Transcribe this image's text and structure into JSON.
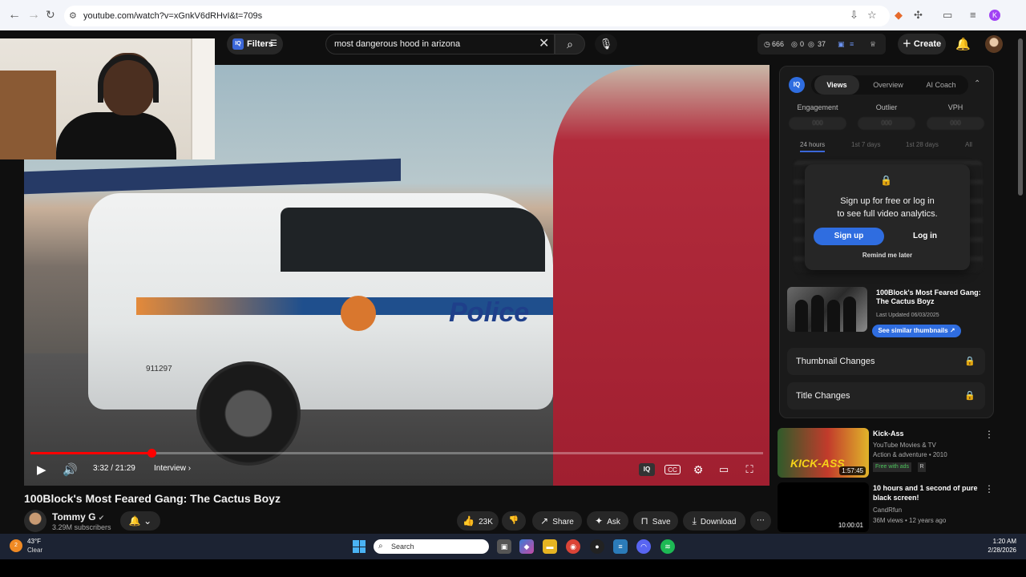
{
  "browser": {
    "url": "youtube.com/watch?v=xGnkV6dRHvI&t=709s",
    "profile_initial": "K"
  },
  "header": {
    "filters_label": "Filters",
    "search_query": "most dangerous hood in arizona",
    "stats": {
      "views": "666",
      "likes": "0",
      "comments": "37"
    },
    "create_label": "Create"
  },
  "player": {
    "current_time": "3:32",
    "duration": "21:29",
    "time_display": "3:32 / 21:29",
    "chapter": "Interview",
    "progress": 0.165,
    "video_overlay_text": "Police",
    "unit_number": "911297"
  },
  "video": {
    "title": "100Block's Most Feared Gang: The Cactus Boyz",
    "channel": "Tommy G",
    "subscribers": "3.29M subscribers",
    "likes": "23K",
    "share_label": "Share",
    "ask_label": "Ask",
    "save_label": "Save",
    "download_label": "Download"
  },
  "iq_panel": {
    "logo": "IQ",
    "tabs": [
      "Views",
      "Overview",
      "AI Coach"
    ],
    "active_tab": "Views",
    "metrics": [
      "Engagement",
      "Outlier",
      "VPH"
    ],
    "metric_values": [
      "000",
      "000",
      "000"
    ],
    "ranges": [
      "24 hours",
      "1st 7 days",
      "1st 28 days",
      "All"
    ],
    "signup_line1": "Sign up for free or log in",
    "signup_line2": "to see full video analytics.",
    "signup_button": "Sign up",
    "login_button": "Log in",
    "remind_label": "Remind me later",
    "thumb_title": "100Block's Most Feared Gang: The Cactus Boyz",
    "thumb_updated": "Last Updated 06/03/2025",
    "similar_button": "See similar thumbnails ↗",
    "thumbnail_changes": "Thumbnail Changes",
    "title_changes": "Title Changes"
  },
  "recommendations": [
    {
      "title": "Kick-Ass",
      "line1": "YouTube Movies & TV",
      "line2": "Action & adventure • 2010",
      "badge": "Free with ads",
      "rating": "R",
      "duration": "1:57:45",
      "thumb_text": "KICK-ASS"
    },
    {
      "title": "10 hours and 1 second of pure black screen!",
      "line1": "CandRfun",
      "line2": "36M views • 12 years ago",
      "duration": "10:00:01"
    }
  ],
  "taskbar": {
    "weather_badge": "2",
    "temperature": "43°F",
    "condition": "Clear",
    "search_placeholder": "Search",
    "time": "1:20 AM",
    "date": "2/28/2026"
  },
  "colors": {
    "accent_red": "#ff0000",
    "iq_blue": "#2f6de0",
    "free_green": "#4cc35b"
  }
}
